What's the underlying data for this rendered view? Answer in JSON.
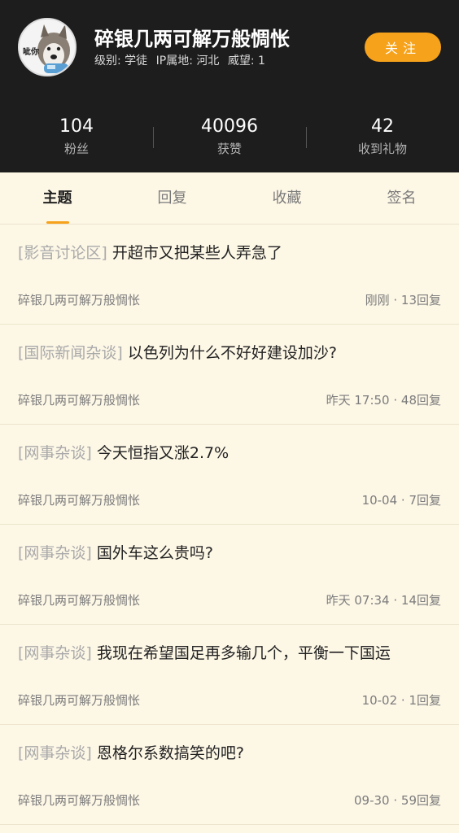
{
  "profile": {
    "avatar_text": "呲你",
    "username": "碎银几两可解万般惆怅",
    "level": "级别: 学徒",
    "ip": "IP属地: 河北",
    "prestige": "威望: 1",
    "follow_label": "关注"
  },
  "stats": [
    {
      "value": "104",
      "label": "粉丝"
    },
    {
      "value": "40096",
      "label": "获赞"
    },
    {
      "value": "42",
      "label": "收到礼物"
    }
  ],
  "tabs": [
    {
      "label": "主题",
      "active": true
    },
    {
      "label": "回复",
      "active": false
    },
    {
      "label": "收藏",
      "active": false
    },
    {
      "label": "签名",
      "active": false
    }
  ],
  "posts": [
    {
      "forum": "[影音讨论区]",
      "title": "开超市又把某些人弄急了",
      "author": "碎银几两可解万般惆怅",
      "info": "刚刚 · 13回复"
    },
    {
      "forum": "[国际新闻杂谈]",
      "title": "以色列为什么不好好建设加沙?",
      "author": "碎银几两可解万般惆怅",
      "info": "昨天 17:50 · 48回复"
    },
    {
      "forum": "[网事杂谈]",
      "title": "今天恒指又涨2.7%",
      "author": "碎银几两可解万般惆怅",
      "info": "10-04 · 7回复"
    },
    {
      "forum": "[网事杂谈]",
      "title": "国外车这么贵吗?",
      "author": "碎银几两可解万般惆怅",
      "info": "昨天 07:34 · 14回复"
    },
    {
      "forum": "[网事杂谈]",
      "title": "我现在希望国足再多输几个，平衡一下国运",
      "author": "碎银几两可解万般惆怅",
      "info": "10-02 · 1回复"
    },
    {
      "forum": "[网事杂谈]",
      "title": "恩格尔系数搞笑的吧?",
      "author": "碎银几两可解万般惆怅",
      "info": "09-30 · 59回复"
    }
  ]
}
